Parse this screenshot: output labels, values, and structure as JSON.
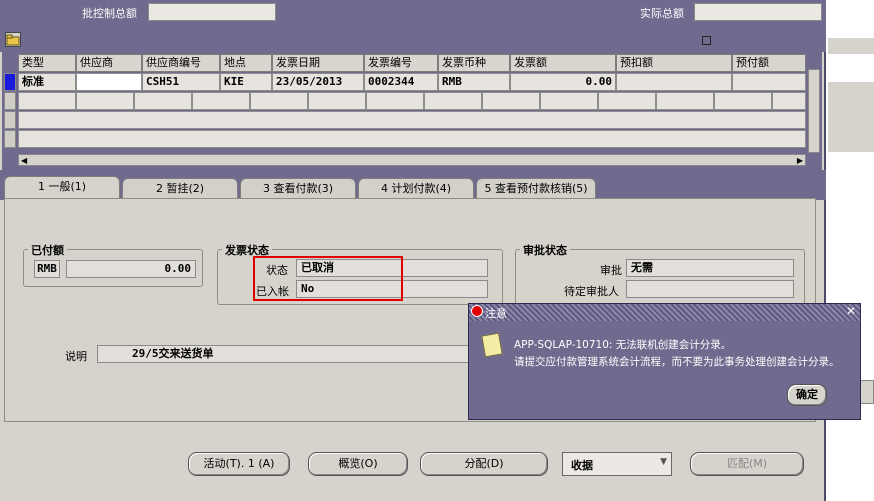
{
  "header": {
    "batch_total_label": "批控制总额",
    "batch_total_value": "",
    "actual_total_label": "实际总额",
    "actual_total_value": ""
  },
  "grid": {
    "columns": [
      "类型",
      "供应商",
      "供应商编号",
      "地点",
      "发票日期",
      "发票编号",
      "发票币种",
      "发票额",
      "预扣额",
      "预付额"
    ],
    "rows": [
      [
        "标准",
        "",
        "CSH51",
        "KIE",
        "23/05/2013",
        "0002344",
        "RMB",
        "0.00",
        "",
        ""
      ]
    ]
  },
  "tabs": [
    "1 一般(1)",
    "2 暂挂(2)",
    "3 查看付款(3)",
    "4 计划付款(4)",
    "5 查看预付款核销(5)"
  ],
  "paid": {
    "title": "已付额",
    "currency": "RMB",
    "amount": "0.00"
  },
  "invoice_status": {
    "title": "发票状态",
    "status_label": "状态",
    "status_value": "已取消",
    "posted_label": "已入帐",
    "posted_value": "No"
  },
  "approval": {
    "title": "审批状态",
    "approval_label": "审批",
    "approval_value": "无需",
    "pending_label": "待定审批人",
    "pending_value": ""
  },
  "description": {
    "label": "说明",
    "value": "29/5交来送货单"
  },
  "buttons": {
    "actions": "活动(T). 1 (A)",
    "overview": "概览(O)",
    "distribute": "分配(D)",
    "select_value": "收据",
    "match": "匹配(M)"
  },
  "dialog": {
    "title": "注意",
    "line1": "APP-SQLAP-10710: 无法联机创建会计分录。",
    "line2": "请提交应付款管理系统会计流程，而不要为此事务处理创建会计分录。",
    "ok": "确定"
  },
  "colors": {
    "window_frame": "#6f6a8e",
    "panel": "#d6d3cc",
    "highlight": "#e00000"
  }
}
